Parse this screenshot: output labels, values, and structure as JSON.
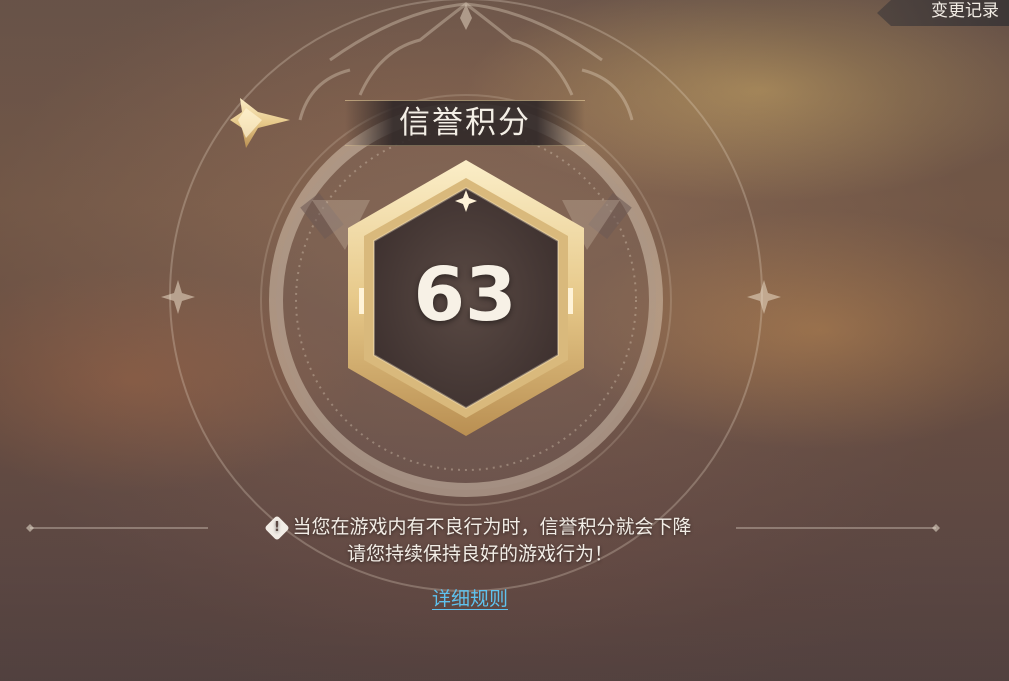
{
  "header": {
    "history_label": "变更记录"
  },
  "credit": {
    "title": "信誉积分",
    "score": "63"
  },
  "notice": {
    "line1": "当您在游戏内有不良行为时，信誉积分就会下降",
    "line2": "请您持续保持良好的游戏行为！",
    "icon": "warning-diamond-icon"
  },
  "links": {
    "rules_label": "详细规则"
  },
  "colors": {
    "gold": "#e8cf95",
    "link": "#5fc2ee",
    "text": "#f2ede6"
  }
}
